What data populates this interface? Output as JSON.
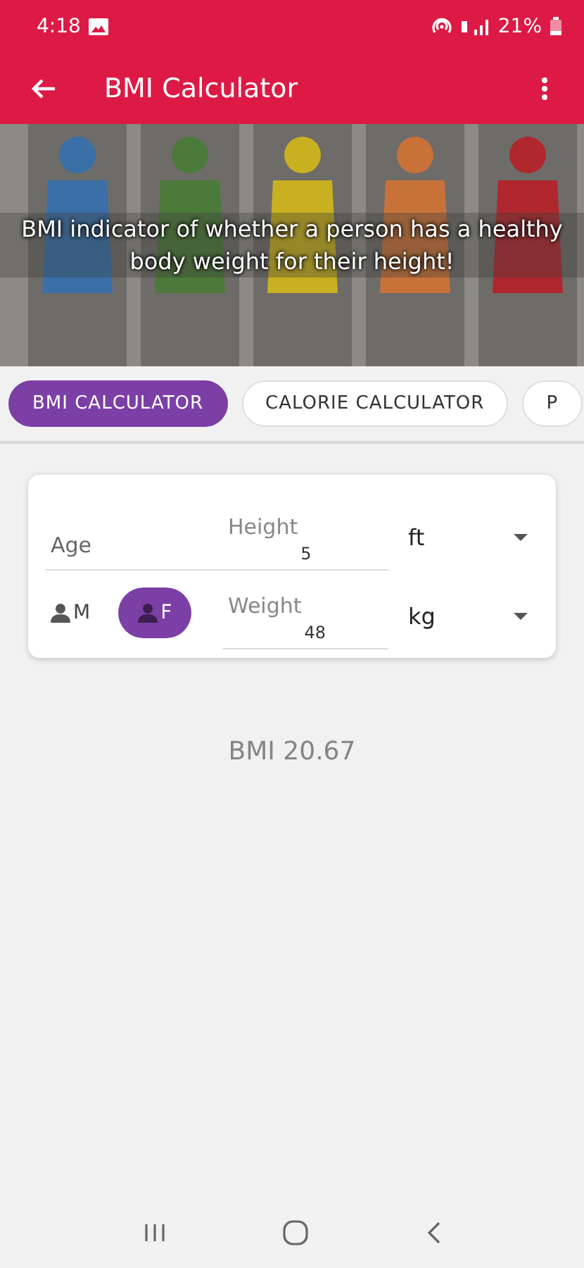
{
  "status_bar": {
    "time": "4:18",
    "battery": "21%"
  },
  "app_bar": {
    "title": "BMI Calculator"
  },
  "banner": {
    "kind": "picture",
    "caption": "BMI indicator of whether a person has a healthy body weight for their height!"
  },
  "tabs": [
    {
      "label": "BMI CALCULATOR",
      "selected": true
    },
    {
      "label": "CALORIE CALCULATOR",
      "selected": false
    },
    {
      "label": "P",
      "selected": false
    }
  ],
  "form": {
    "age": {
      "placeholder": "Age"
    },
    "height": {
      "label": "Height",
      "value": "5",
      "unit": "ft"
    },
    "weight": {
      "label": "Weight",
      "value": "48",
      "unit": "kg"
    },
    "genders": [
      {
        "label": "M",
        "selected": false
      },
      {
        "label": "F",
        "selected": true
      }
    ]
  },
  "result": "BMI 20.67"
}
